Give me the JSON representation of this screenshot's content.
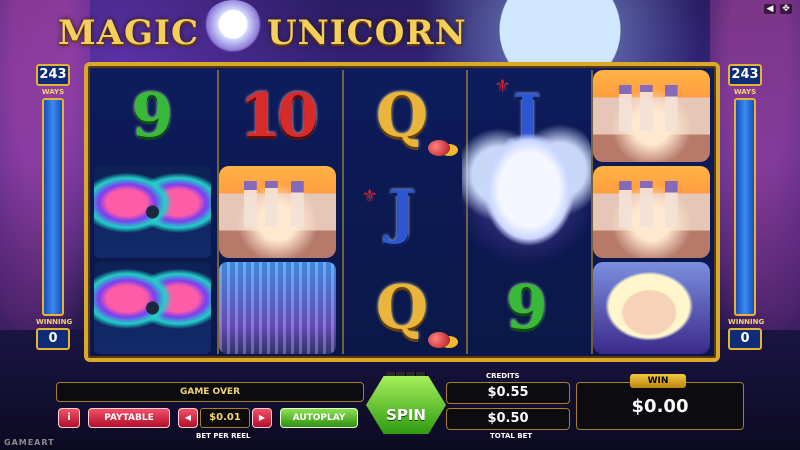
{
  "game": {
    "title": "MAGIC UNICORN",
    "logo_left": "MAGIC",
    "logo_right": "UNICORN"
  },
  "top_controls": {
    "sound_icon": "speaker-icon",
    "fullscreen_icon": "fullscreen-icon"
  },
  "ways": {
    "count": "243",
    "label": "WAYS"
  },
  "winning": {
    "label": "WINNING",
    "count": "0"
  },
  "reels": [
    [
      "9",
      "butterfly",
      "butterfly"
    ],
    [
      "10",
      "castle",
      "waterfall"
    ],
    [
      "Q",
      "J",
      "Q"
    ],
    [
      "J",
      "unicorn",
      "9"
    ],
    [
      "castle",
      "castle",
      "lady"
    ]
  ],
  "status": {
    "text": "GAME OVER"
  },
  "controls": {
    "paytable_label": "PAYTABLE",
    "info_label": "i",
    "bet_per_reel_value": "$0.01",
    "bet_per_reel_label": "BET PER REEL",
    "autoplay_label": "AUTOPLAY",
    "spin_label": "SPIN"
  },
  "credits": {
    "label": "CREDITS",
    "value": "$0.55"
  },
  "total_bet": {
    "label": "TOTAL BET",
    "value": "$0.50"
  },
  "win": {
    "label": "WIN",
    "value": "$0.00"
  },
  "brand": "GAMEART",
  "colors": {
    "gold": "#d9a92b",
    "spin_green": "#4fbf1e",
    "paytable_red": "#d8263e"
  }
}
